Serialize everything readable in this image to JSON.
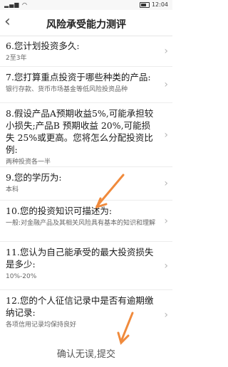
{
  "status_bar": {
    "left": "信号 Wi-Fi",
    "time": "12:04",
    "battery_icon": "battery-icon"
  },
  "nav": {
    "title": "风险承受能力测评",
    "back_icon": "chevron-left-icon"
  },
  "questions": [
    {
      "q": "6.您计划投资多久:",
      "a": "2至3年"
    },
    {
      "q": "7.您打算重点投资于哪些种类的产品:",
      "a": "银行存款、货币市场基金等低风险投资品种"
    },
    {
      "q": "8.假设产品A预期收益5%,可能承担较小损失;产品B 预期收益 20%,可能损失 25%或更高。您将怎么分配投资比例:",
      "a": "两种投资各一半"
    },
    {
      "q": "9.您的学历为:",
      "a": "本科"
    },
    {
      "q": "10.您的投资知识可描述为:",
      "a": "一般:对金融产品及其相关风险具有基本的知识和理解"
    },
    {
      "q": "11.您认为自己能承受的最大投资损失是多少:",
      "a": "10%-20%"
    },
    {
      "q": "12.您的个人征信记录中是否有逾期缴纳记录:",
      "a": "各项信用记录均保持良好"
    }
  ],
  "footer": {
    "submit_label": "确认无误,提交"
  },
  "colors": {
    "arrow": "#f08a3c",
    "chevron": "#b5b5b5"
  }
}
